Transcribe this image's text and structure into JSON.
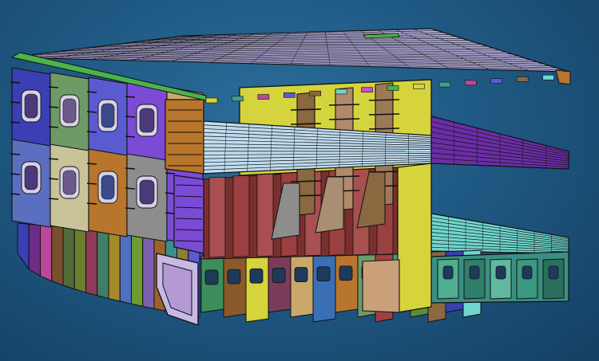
{
  "scene": {
    "subject": "ship-hull-block-cutaway",
    "view": "isometric",
    "colors": {
      "background_center": "#2c6e9b",
      "background_edge": "#153f63",
      "deck_top": "#b7b1e3",
      "deck_mid": "#bfdcef",
      "deck_lower": "#c94fd6",
      "deck_lower_right": "#6fd7cf",
      "mid_right_strip": "#6b2ea6",
      "bulkhead_yellow": "#d5d43d",
      "bulkhead_brown": "#8a6840",
      "bulkhead_tan": "#c9a86a",
      "bulkhead_blue": "#3a3fb4",
      "bulkhead_purple": "#7b4bd6",
      "bulkhead_green": "#6e9a66",
      "bulkhead_orange": "#b8752c",
      "bulkhead_gray": "#8d8d8d",
      "bilge_frame": "#c8b8e6",
      "edge_line": "#111111"
    },
    "bilge_strake_colors": [
      "#3a3fb4",
      "#6d2d86",
      "#b9489a",
      "#7a4f2b",
      "#536a3a",
      "#6d7e2e",
      "#8f3a56",
      "#3f7f64",
      "#a58a2a",
      "#4f6fc0",
      "#6c9c2f",
      "#7d5fb1",
      "#a0622d",
      "#3b8f8a",
      "#8b7f3a",
      "#5b5bd1"
    ]
  }
}
